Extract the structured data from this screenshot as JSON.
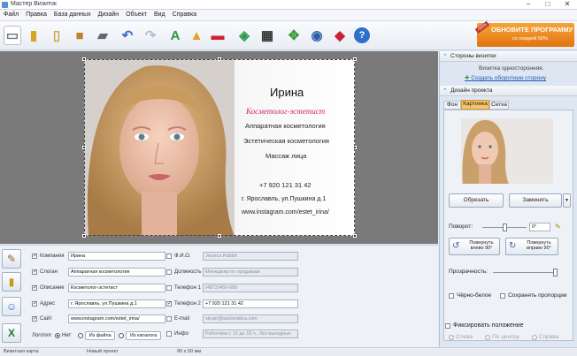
{
  "window": {
    "title": "Мастер Визиток",
    "minimize": "–",
    "maximize": "□",
    "close": "✕"
  },
  "menu": [
    "Файл",
    "Правка",
    "База данных",
    "Дизайн",
    "Объект",
    "Вид",
    "Справка"
  ],
  "promo": {
    "title": "ОБНОВИТЕ ПРОГРАММУ",
    "subtitle": "со скидкой 50%",
    "ribbon": "-50%"
  },
  "card": {
    "name": "Ирина",
    "title": "Косметолог-эстетист",
    "line1": "Аппаратная косметология",
    "line2": "Эстетическая косметология",
    "line3": "Массаж лица",
    "phone": "+7 920 121 31 42",
    "address": "г. Ярославль, ул.Пушкина д.1",
    "site": "www.instagram.com/estet_irina/"
  },
  "fields": {
    "left": [
      {
        "label": "Компания",
        "value": "Ирина",
        "checked": true
      },
      {
        "label": "Слоган",
        "value": "Аппаратная косметология",
        "checked": true
      },
      {
        "label": "Описание",
        "value": "Косметолог-эстетист",
        "checked": true
      },
      {
        "label": "Адрес",
        "value": "г. Ярославль, ул.Пушкина д.1",
        "checked": true
      },
      {
        "label": "Сайт",
        "value": "www.instagram.com/estet_irina/",
        "checked": true
      }
    ],
    "right": [
      {
        "label": "Ф.И.О.",
        "value": "Jessica Rabbit",
        "checked": false
      },
      {
        "label": "Должность",
        "value": "Менеджер по продажам",
        "checked": false
      },
      {
        "label": "Телефон 1",
        "value": "(4872)450-000",
        "checked": false
      },
      {
        "label": "Телефон 2",
        "value": "+7 920 121 31 42",
        "checked": true
      },
      {
        "label": "E-mail",
        "value": "skyair@automatica.com",
        "checked": false
      },
      {
        "label": "Инфо",
        "value": "Работаем с 10 до 18 ч., без выходных",
        "checked": false
      }
    ],
    "logo_label": "Логотип",
    "logo_none": "Нет",
    "logo_file": "Из файла",
    "logo_catalog": "Из каталога"
  },
  "sidebar": {
    "sides_header": "Стороны визитки",
    "one_sided": "Визитка односторонняя.",
    "create_back": "Создать оборотную сторону",
    "design_header": "Дизайн проекта",
    "tabs": [
      "Фон",
      "Картинка",
      "Сетка"
    ],
    "crop": "Обрезать",
    "replace": "Заменить",
    "rotation_label": "Поворот:",
    "rotation_value": "0°",
    "rotate_left": "Повернуть влево 90°",
    "rotate_right": "Повернуть вправо 90°",
    "transparency": "Прозрачность:",
    "bw": "Чёрно-белое",
    "keep_ratio": "Сохранять пропорции",
    "fix_position": "Фиксировать положение",
    "left": "Слева",
    "center": "По центру",
    "right": "Справа"
  },
  "status": {
    "type": "Визитная карта",
    "project": "Новый проект",
    "size": "90 x 50 мм"
  }
}
